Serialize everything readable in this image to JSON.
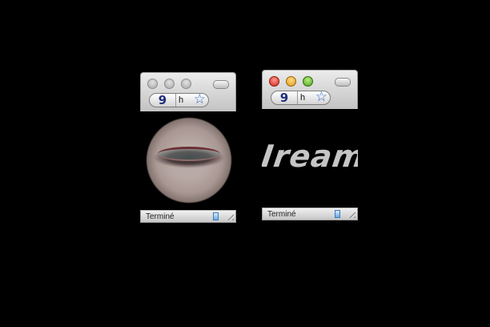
{
  "window_left": {
    "nav": {
      "count": "9",
      "url_fragment": "h",
      "bookmark_icon": "star-icon"
    },
    "status": {
      "label": "Terminé"
    },
    "content": {
      "image": "blurred-eye-closeup"
    }
  },
  "window_right": {
    "nav": {
      "count": "9",
      "url_fragment": "h",
      "bookmark_icon": "star-icon"
    },
    "status": {
      "label": "Terminé"
    },
    "content": {
      "text": "Iream"
    }
  },
  "colors": {
    "close": "#d2231b",
    "minimize": "#e39a14",
    "zoom": "#4fa11a",
    "nav_number": "#1f2f7a",
    "star": "#2f68c8"
  }
}
